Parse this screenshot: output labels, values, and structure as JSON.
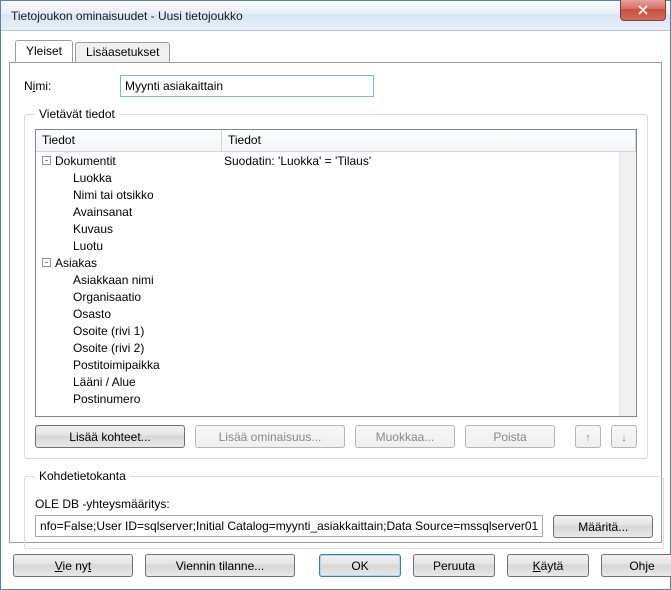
{
  "window": {
    "title": "Tietojoukon ominaisuudet - Uusi tietojoukko"
  },
  "tabs": {
    "general": "Yleiset",
    "advanced": "Lisäasetukset"
  },
  "name": {
    "label_pre": "N",
    "label_ul": "i",
    "label_post": "mi:",
    "value": "Myynti asiakaittain"
  },
  "export_group": "Vietävät tiedot",
  "tree": {
    "col1": "Tiedot",
    "col2": "Tiedot",
    "row_filter": "Suodatin: 'Luokka' = 'Tilaus'",
    "items": [
      {
        "level": 0,
        "expand": "-",
        "label": "Dokumentit"
      },
      {
        "level": 1,
        "label": "Luokka"
      },
      {
        "level": 1,
        "label": "Nimi tai otsikko"
      },
      {
        "level": 1,
        "label": "Avainsanat"
      },
      {
        "level": 1,
        "label": "Kuvaus"
      },
      {
        "level": 1,
        "label": "Luotu"
      },
      {
        "level": 0,
        "expand": "-",
        "label": "Asiakas"
      },
      {
        "level": 1,
        "label": "Asiakkaan nimi"
      },
      {
        "level": 1,
        "label": "Organisaatio"
      },
      {
        "level": 1,
        "label": "Osasto"
      },
      {
        "level": 1,
        "label": "Osoite (rivi 1)"
      },
      {
        "level": 1,
        "label": "Osoite (rivi 2)"
      },
      {
        "level": 1,
        "label": "Postitoimipaikka"
      },
      {
        "level": 1,
        "label": "Lääni / Alue"
      },
      {
        "level": 1,
        "label": "Postinumero"
      }
    ]
  },
  "buttons": {
    "add_items": "Lisää kohteet...",
    "add_prop": "Lisää ominaisuus...",
    "edit": "Muokkaa...",
    "remove": "Poista",
    "up": "↑",
    "down": "↓"
  },
  "db_group": "Kohdetietokanta",
  "db_label": "OLE DB -yhteysmääritys:",
  "db_value": "nfo=False;User ID=sqlserver;Initial Catalog=myynti_asiakkaittain;Data Source=mssqlserver01",
  "db_define": "Määritä...",
  "footer": {
    "export_now": "Vie nyt",
    "export_status": "Viennin tilanne...",
    "ok": "OK",
    "cancel": "Peruuta",
    "apply": "Käytä",
    "help": "Ohje"
  }
}
